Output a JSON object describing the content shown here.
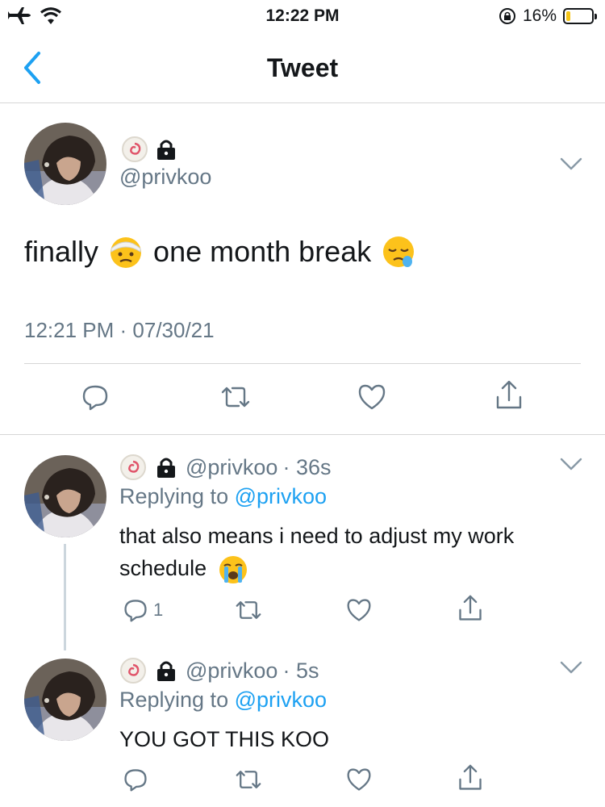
{
  "status_bar": {
    "time": "12:22 PM",
    "battery_percent_label": "16%",
    "battery_level": 0.16,
    "icons": [
      "airplane-icon",
      "wifi-icon",
      "orientation-lock-icon",
      "battery-icon"
    ]
  },
  "nav": {
    "title": "Tweet",
    "back_icon": "chevron-left-icon"
  },
  "main_tweet": {
    "handle": "@privkoo",
    "badges": [
      "narutomaki-emoji",
      "lock-icon"
    ],
    "text_parts": [
      "finally",
      "one month break"
    ],
    "emojis": [
      "head-bandage-emoji",
      "sleepy-face-emoji"
    ],
    "timestamp": "12:21 PM · 07/30/21",
    "actions": [
      "reply-icon",
      "retweet-icon",
      "like-icon",
      "share-icon"
    ]
  },
  "replies": [
    {
      "handle": "@privkoo",
      "time": "· 36s",
      "replying_prefix": "Replying to",
      "replying_to": "@privkoo",
      "text": "that also means i need to adjust my work schedule",
      "emoji": "loudly-crying-face-emoji",
      "reply_count": "1"
    },
    {
      "handle": "@privkoo",
      "time": "· 5s",
      "replying_prefix": "Replying to",
      "replying_to": "@privkoo",
      "text": "YOU GOT THIS KOO",
      "reply_count": ""
    }
  ],
  "colors": {
    "accent": "#1da1f2",
    "muted_text": "#657786",
    "divider": "#d6d6d6",
    "thread_line": "#ccd6dd",
    "battery_fill": "#f5c518"
  }
}
